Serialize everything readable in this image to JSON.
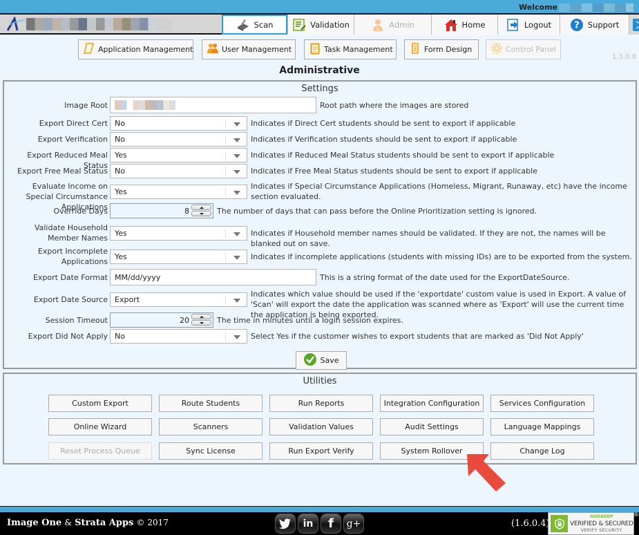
{
  "header": {
    "welcome_label": "Welcome",
    "nav_tabs": [
      {
        "label": "Scan",
        "icon": "scanner-icon",
        "active": true,
        "disabled": false
      },
      {
        "label": "Validation",
        "icon": "checklist-icon",
        "active": false,
        "disabled": false
      },
      {
        "label": "Admin",
        "icon": "admin-user-icon",
        "active": false,
        "disabled": true
      },
      {
        "label": "Home",
        "icon": "home-icon",
        "active": false,
        "disabled": false
      },
      {
        "label": "Logout",
        "icon": "logout-icon",
        "active": false,
        "disabled": false
      },
      {
        "label": "Support",
        "icon": "help-icon",
        "active": false,
        "disabled": false
      }
    ]
  },
  "subtoolbar": {
    "items": [
      {
        "label": "Application Management",
        "icon": "document-icon",
        "disabled": false
      },
      {
        "label": "User Management",
        "icon": "users-icon",
        "disabled": false
      },
      {
        "label": "Task Management",
        "icon": "clipboard-icon",
        "disabled": false
      },
      {
        "label": "Form Design",
        "icon": "form-icon",
        "disabled": false
      },
      {
        "label": "Control Panel",
        "icon": "gear-icon",
        "disabled": true
      }
    ],
    "version": "1.3.0.0"
  },
  "page_title": "Administrative",
  "settings": {
    "title": "Settings",
    "rows": [
      {
        "label": "Image Root",
        "type": "text",
        "value": "",
        "description": "Root path where the images are stored"
      },
      {
        "label": "Export Direct Cert",
        "type": "select",
        "value": "No",
        "description": "Indicates if Direct Cert students should be sent to export if applicable"
      },
      {
        "label": "Export Verification",
        "type": "select",
        "value": "No",
        "description": "Indicates if Verification students should be sent to export if applicable"
      },
      {
        "label": "Export Reduced Meal Status",
        "type": "select",
        "value": "Yes",
        "description": "Indicates if Reduced Meal Status students should be sent to export if applicable"
      },
      {
        "label": "Export Free Meal Status",
        "type": "select",
        "value": "No",
        "description": "Indicates if Free Meal Status students should be sent to export if applicable"
      },
      {
        "label": "Evaluate Income on Special Circumstance Applications",
        "type": "select",
        "value": "Yes",
        "description": "Indicates if Special Circumstance Applications (Homeless, Migrant, Runaway, etc) have the income section evaluated."
      },
      {
        "label": "Override Days",
        "type": "numeric",
        "value": "8",
        "description": "The number of days that can pass before the Online Prioritization setting is ignored."
      },
      {
        "label": "Validate Household Member Names",
        "type": "select",
        "value": "Yes",
        "description": "Indicates if Household member names should be validated. If they are not, the names will be blanked out on save."
      },
      {
        "label": "Export Incomplete Applications",
        "type": "select",
        "value": "Yes",
        "description": "Indicates if incomplete applications (students with missing IDs) are to be exported from the system."
      },
      {
        "label": "Export Date Format",
        "type": "text",
        "value": "MM/dd/yyyy",
        "description": "This is a string format of the date used for the ExportDateSource."
      },
      {
        "label": "Export Date Source",
        "type": "select",
        "value": "Export",
        "description": "Indicates which value should be used if the 'exportdate' custom value is used in Export. A value of 'Scan' will export the date the application was scanned where as 'Export' will use the current time the application is being exported."
      },
      {
        "label": "Session Timeout",
        "type": "numeric",
        "value": "20",
        "description": "The time in minutes until a login session expires."
      },
      {
        "label": "Export Did Not Apply",
        "type": "select",
        "value": "No",
        "description": "Select Yes if the customer wishes to export students that are marked as 'Did Not Apply'"
      }
    ],
    "save_label": "Save"
  },
  "utilities": {
    "title": "Utilities",
    "buttons": [
      {
        "label": "Custom Export",
        "disabled": false
      },
      {
        "label": "Route Students",
        "disabled": false
      },
      {
        "label": "Run Reports",
        "disabled": false
      },
      {
        "label": "Integration Configuration",
        "disabled": false
      },
      {
        "label": "Services Configuration",
        "disabled": false
      },
      {
        "label": "Online Wizard",
        "disabled": false
      },
      {
        "label": "Scanners",
        "disabled": false
      },
      {
        "label": "Validation Values",
        "disabled": false
      },
      {
        "label": "Audit Settings",
        "disabled": false
      },
      {
        "label": "Language Mappings",
        "disabled": false
      },
      {
        "label": "Reset Process Queue",
        "disabled": true
      },
      {
        "label": "Sync License",
        "disabled": false
      },
      {
        "label": "Run Export Verify",
        "disabled": false
      },
      {
        "label": "System Rollover",
        "disabled": false
      },
      {
        "label": "Change Log",
        "disabled": false
      }
    ]
  },
  "footer": {
    "brand1": "Image One",
    "amp": "&",
    "brand2": "Strata Apps",
    "copyright": "© 2017",
    "socials": [
      {
        "name": "twitter",
        "glyph": "t"
      },
      {
        "name": "linkedin",
        "glyph": "in"
      },
      {
        "name": "facebook",
        "glyph": "f"
      },
      {
        "name": "google-plus",
        "glyph": "g+"
      }
    ],
    "version": "(1.6.0.4)",
    "badge": {
      "top": "GODADDY",
      "middle": "VERIFIED & SECURED",
      "bottom": "VERIFY SECURITY",
      "reg": "®"
    }
  },
  "colors": {
    "accent_blue": "#4aaada",
    "active_tab_border": "#29a0e0",
    "pointer_arrow": "#e84a3c",
    "godaddy_green": "#7dbb2e"
  }
}
